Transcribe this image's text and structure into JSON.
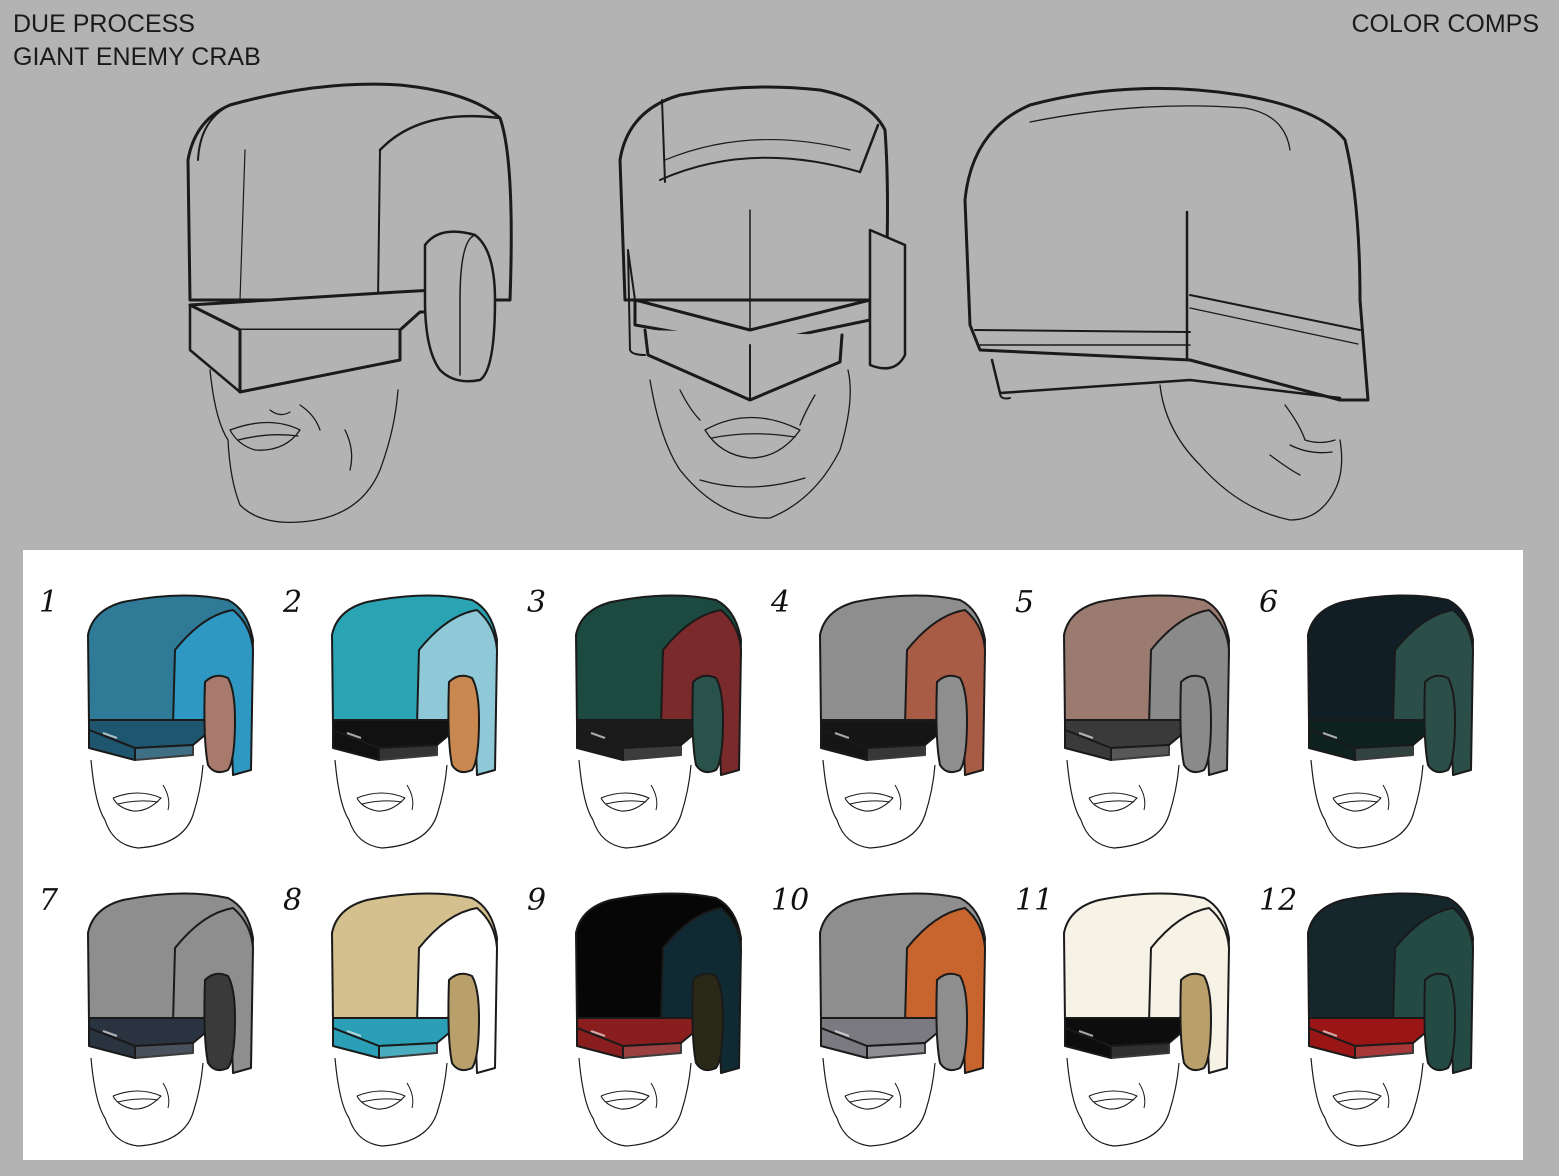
{
  "header": {
    "project": "DUE PROCESS",
    "subject": "GIANT ENEMY CRAB",
    "sheet": "COLOR COMPS"
  },
  "views": [
    "three-quarter",
    "front",
    "side"
  ],
  "comps": [
    {
      "number": "1",
      "dome": "#2f7a96",
      "side": "#2e97c2",
      "visor": "#1e5670",
      "ear": "#a87a6e"
    },
    {
      "number": "2",
      "dome": "#2aa3b3",
      "side": "#8fc8d6",
      "visor": "#111111",
      "ear": "#c98850"
    },
    {
      "number": "3",
      "dome": "#1c4a40",
      "side": "#7a2a2a",
      "visor": "#1b1b1b",
      "ear": "#28524a"
    },
    {
      "number": "4",
      "dome": "#8e8e8e",
      "side": "#a85c45",
      "visor": "#151515",
      "ear": "#8e8e8e"
    },
    {
      "number": "5",
      "dome": "#9b7a70",
      "side": "#8a8a8a",
      "visor": "#3a3a3a",
      "ear": "#8a8a8a"
    },
    {
      "number": "6",
      "dome": "#111e26",
      "side": "#2b4f48",
      "visor": "#0e2220",
      "ear": "#2b4f48"
    },
    {
      "number": "7",
      "dome": "#8e8e8e",
      "side": "#8e8e8e",
      "visor": "#2a3440",
      "ear": "#3a3a3a"
    },
    {
      "number": "8",
      "dome": "#d3c08e",
      "side": "#ffffff",
      "visor": "#2a9fb5",
      "ear": "#b99f6a"
    },
    {
      "number": "9",
      "dome": "#060606",
      "side": "#0f2a33",
      "visor": "#8a1e1e",
      "ear": "#2a2816"
    },
    {
      "number": "10",
      "dome": "#8e8e8e",
      "side": "#c8642e",
      "visor": "#7a7a80",
      "ear": "#8e8e8e"
    },
    {
      "number": "11",
      "dome": "#f7f2e6",
      "side": "#f7f2e6",
      "visor": "#0d0d0d",
      "ear": "#b99f6a"
    },
    {
      "number": "12",
      "dome": "#15262c",
      "side": "#244a44",
      "visor": "#9a1515",
      "ear": "#244a44"
    }
  ]
}
